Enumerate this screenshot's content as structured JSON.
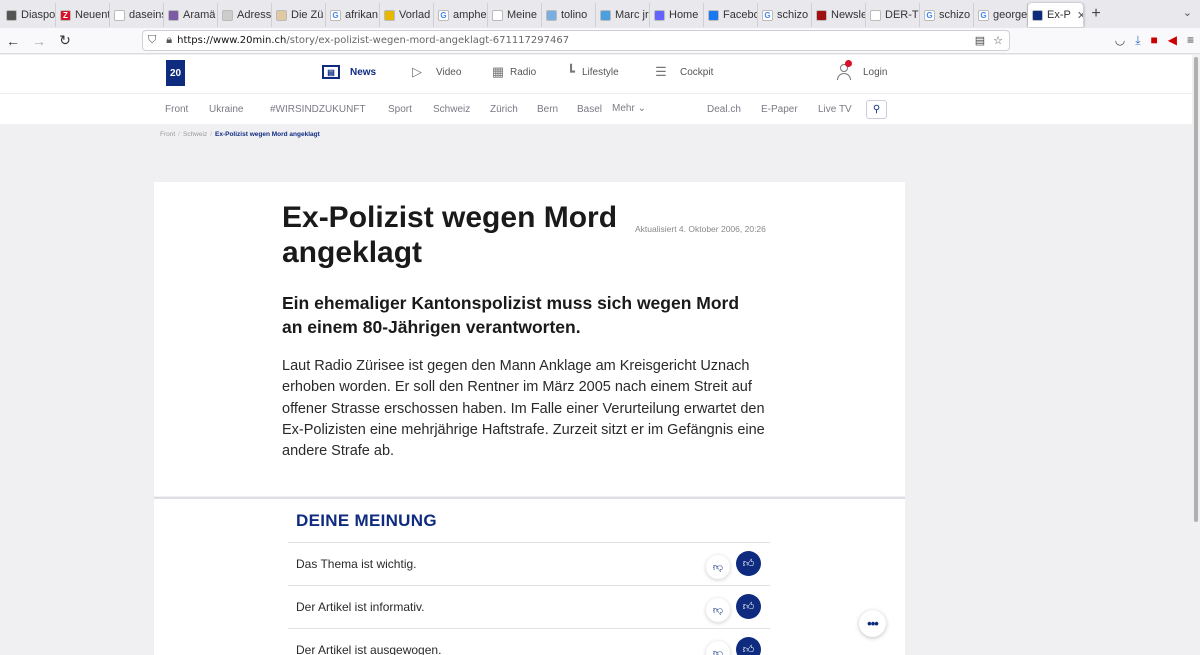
{
  "browser": {
    "tabs": [
      {
        "label": "Diaspo",
        "fav": "#555"
      },
      {
        "label": "Neuent",
        "fav": "#d8102a",
        "glyph": "Z"
      },
      {
        "label": "daseinsana",
        "fav": "#ffffff"
      },
      {
        "label": "Aramä",
        "fav": "#7b5aa6"
      },
      {
        "label": "Adress",
        "fav": "#ccc"
      },
      {
        "label": "Die Zü",
        "fav": "#e0c8a0"
      },
      {
        "label": "afrikan",
        "fav": "#ffffff",
        "glyph": "G"
      },
      {
        "label": "Vorlad",
        "fav": "#e8b800"
      },
      {
        "label": "amphe",
        "fav": "#ffffff",
        "glyph": "G"
      },
      {
        "label": "Meine",
        "fav": "#ffffff"
      },
      {
        "label": "tolino",
        "fav": "#7aaee0"
      },
      {
        "label": "Marc jr",
        "fav": "#4a9fe0"
      },
      {
        "label": "Home",
        "fav": "#6364ff"
      },
      {
        "label": "Facebo",
        "fav": "#1877f2"
      },
      {
        "label": "schizo",
        "fav": "#ffffff",
        "glyph": "G"
      },
      {
        "label": "Newsle",
        "fav": "#a01010"
      },
      {
        "label": "DER-Td_D",
        "fav": "#ffffff"
      },
      {
        "label": "schizo",
        "fav": "#ffffff",
        "glyph": "G"
      },
      {
        "label": "george",
        "fav": "#ffffff",
        "glyph": "G"
      },
      {
        "label": "Ex-P",
        "fav": "#0e2b80",
        "active": true
      }
    ],
    "url_domain": "https://www.20min.ch",
    "url_path": "/story/ex-polizist-wegen-mord-angeklagt-671117297467"
  },
  "site": {
    "logo_text": "20",
    "main_nav": [
      {
        "label": "News",
        "icon": "news-icon",
        "active": true
      },
      {
        "label": "Video",
        "icon": "play-icon"
      },
      {
        "label": "Radio",
        "icon": "radio-icon"
      },
      {
        "label": "Lifestyle",
        "icon": "lifestyle-icon"
      },
      {
        "label": "Cockpit",
        "icon": "sliders-icon"
      }
    ],
    "login_label": "Login",
    "sub_nav": [
      "Front",
      "Ukraine",
      "#WIRSINDZUKUNFT",
      "Sport",
      "Schweiz",
      "Zürich",
      "Bern",
      "Basel",
      "Mehr",
      "Deal.ch",
      "E-Paper",
      "Live TV"
    ]
  },
  "breadcrumb": [
    "Front",
    "Schweiz",
    "Ex-Polizist wegen Mord angeklagt"
  ],
  "article": {
    "title": "Ex-Polizist wegen Mord angeklagt",
    "updated": "Aktualisiert 4. Oktober 2006, 20:26",
    "lead": "Ein ehemaliger Kantonspolizist muss sich wegen Mord an einem 80-Jährigen verantworten.",
    "body": "Laut Radio Zürisee ist gegen den Mann Anklage am Kreisgericht Uznach erhoben worden. Er soll den Rentner im März 2005 nach einem Streit auf offener Strasse erschossen haben. Im Falle einer Verurteilung erwartet den Ex-Polizisten eine mehrjährige Haftstrafe. Zurzeit sitzt er im Gefängnis eine andere Strafe ab."
  },
  "opinion": {
    "title": "DEINE MEINUNG",
    "rows": [
      "Das Thema ist wichtig.",
      "Der Artikel ist informativ.",
      "Der Artikel ist ausgewogen."
    ]
  },
  "colors": {
    "brand": "#0e2b80",
    "alert": "#d8102a"
  }
}
